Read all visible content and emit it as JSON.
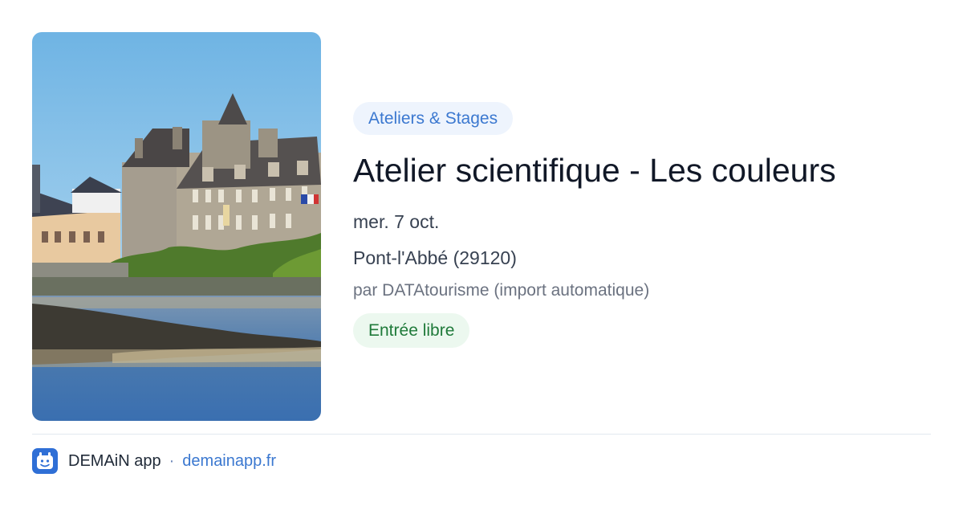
{
  "event": {
    "category": "Ateliers & Stages",
    "title": "Atelier scientifique - Les couleurs",
    "date": "mer. 7 oct.",
    "location": "Pont-l'Abbé (29120)",
    "author": "par DATAtourisme (import automatique)",
    "price": "Entrée libre"
  },
  "footer": {
    "app_name": "DEMAiN app",
    "separator": "·",
    "link": "demainapp.fr"
  },
  "colors": {
    "accent": "#3b78d0",
    "category_bg": "#eef4fd",
    "price_bg": "#ecf8ef",
    "price_text": "#1f7a3a"
  }
}
